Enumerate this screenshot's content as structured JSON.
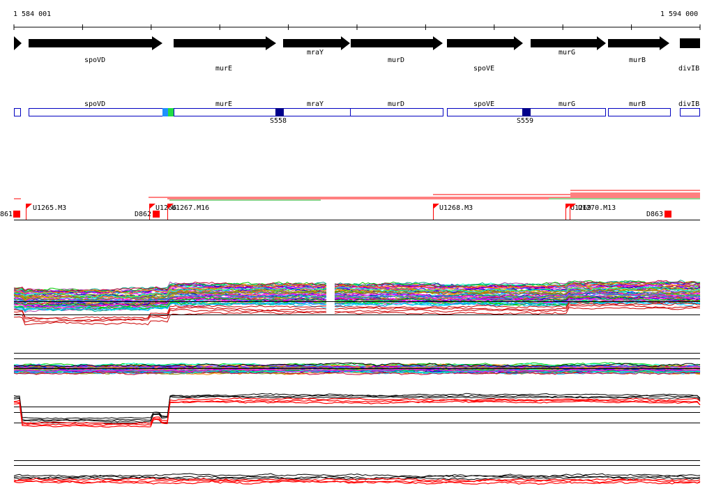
{
  "ruler": {
    "start_label": "1 584 001",
    "end_label": "1 594 000"
  },
  "genes": [
    "spoVD",
    "murE",
    "mraY",
    "murD",
    "spoVE",
    "murG",
    "murB",
    "divIB"
  ],
  "segments": [
    "S558",
    "S559"
  ],
  "probes": [
    "861",
    "U1265.M3",
    "D862",
    "U1266",
    "U1267.M16",
    "U1268.M3",
    "U1269",
    "U1270.M13",
    "D863"
  ],
  "colors": {
    "gene_arrow": "#000000",
    "gene_box": "#0000c0",
    "segment": "#00008b",
    "probe_flag": "#ff0000",
    "track_line": "#000000"
  }
}
